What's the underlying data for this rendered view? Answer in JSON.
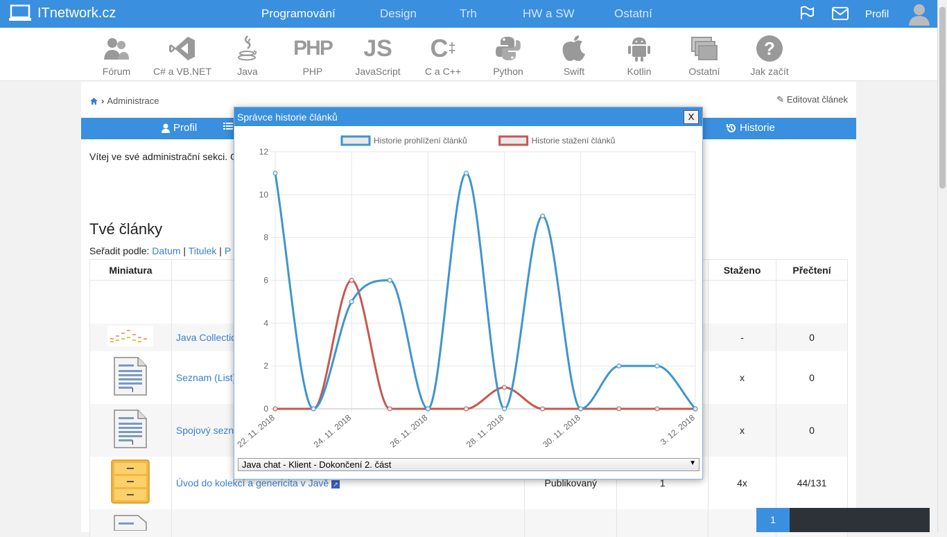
{
  "site": {
    "name": "ITnetwork.cz"
  },
  "topnav": [
    "Programování",
    "Design",
    "Trh",
    "HW a SW",
    "Ostatní"
  ],
  "topnav_active": "Programování",
  "profile_label": "Profil",
  "categories": [
    {
      "label": "Fórum",
      "icon": "forum-icon"
    },
    {
      "label": "C# a VB.NET",
      "icon": "visual-studio-icon"
    },
    {
      "label": "Java",
      "icon": "java-icon"
    },
    {
      "label": "PHP",
      "icon": "php-icon"
    },
    {
      "label": "JavaScript",
      "icon": "js-icon"
    },
    {
      "label": "C a C++",
      "icon": "cpp-icon"
    },
    {
      "label": "Python",
      "icon": "python-icon"
    },
    {
      "label": "Swift",
      "icon": "apple-icon"
    },
    {
      "label": "Kotlin",
      "icon": "android-icon"
    },
    {
      "label": "Ostatní",
      "icon": "windows-stack-icon"
    },
    {
      "label": "Jak začít",
      "icon": "question-icon"
    }
  ],
  "breadcrumb": {
    "current": "Administrace"
  },
  "edit_link": "Editovat článek",
  "tabs": {
    "profil": "Profil",
    "historie": "Historie"
  },
  "welcome_text": "Vítej ve své administrační sekci. O",
  "section_title": "Tvé články",
  "sort": {
    "label": "Seřadit podle:",
    "options": [
      "Datum",
      "Titulek",
      "P"
    ]
  },
  "table": {
    "headers": {
      "thumb": "Miniatura",
      "downloaded": "Staženo",
      "reads": "Přečtení"
    },
    "rows": [
      {
        "title": "",
        "status": "",
        "count": "",
        "downloaded": "",
        "reads": "",
        "thumb": "none"
      },
      {
        "title": "Java Collection",
        "status": "",
        "count": "",
        "downloaded": "-",
        "reads": "0",
        "thumb": "chart"
      },
      {
        "title": "Seznam (List)",
        "status": "",
        "count": "",
        "downloaded": "x",
        "reads": "0",
        "thumb": "doc"
      },
      {
        "title": "Spojový sezna",
        "status": "",
        "count": "",
        "downloaded": "x",
        "reads": "0",
        "thumb": "doc"
      },
      {
        "title": "Úvod do kolekcí a genericita v Javě",
        "status": "Publikovaný",
        "count": "1",
        "downloaded": "4x",
        "reads": "44/131",
        "thumb": "cabinet"
      }
    ]
  },
  "pager": {
    "current": "1"
  },
  "modal": {
    "title": "Správce historie článků",
    "close_label": "X",
    "select_value": "Java chat - Klient - Dokončení 2. část"
  },
  "chart_data": {
    "type": "line",
    "x": [
      "22. 11. 2018",
      "23. 11. 2018",
      "24. 11. 2018",
      "25. 11. 2018",
      "26. 11. 2018",
      "27. 11. 2018",
      "28. 11. 2018",
      "29. 11. 2018",
      "30. 11. 2018",
      "1. 12. 2018",
      "2. 12. 2018",
      "3. 12. 2018"
    ],
    "x_tick_labels": [
      "22. 11. 2018",
      "24. 11. 2018",
      "26. 11. 2018",
      "28. 11. 2018",
      "30. 11. 2018",
      "3. 12. 2018"
    ],
    "series": [
      {
        "name": "Historie prohlížení článků",
        "color": "#3e95cd",
        "values": [
          11,
          0,
          5,
          6,
          0,
          11,
          0,
          9,
          0,
          2,
          2,
          0
        ]
      },
      {
        "name": "Historie stažení článků",
        "color": "#c45850",
        "values": [
          0,
          0,
          6,
          0,
          0,
          0,
          1,
          0,
          0,
          0,
          0,
          0
        ]
      }
    ],
    "ylim": [
      0,
      12
    ],
    "yticks": [
      0,
      2,
      4,
      6,
      8,
      10,
      12
    ],
    "grid": true,
    "legend_position": "top"
  }
}
